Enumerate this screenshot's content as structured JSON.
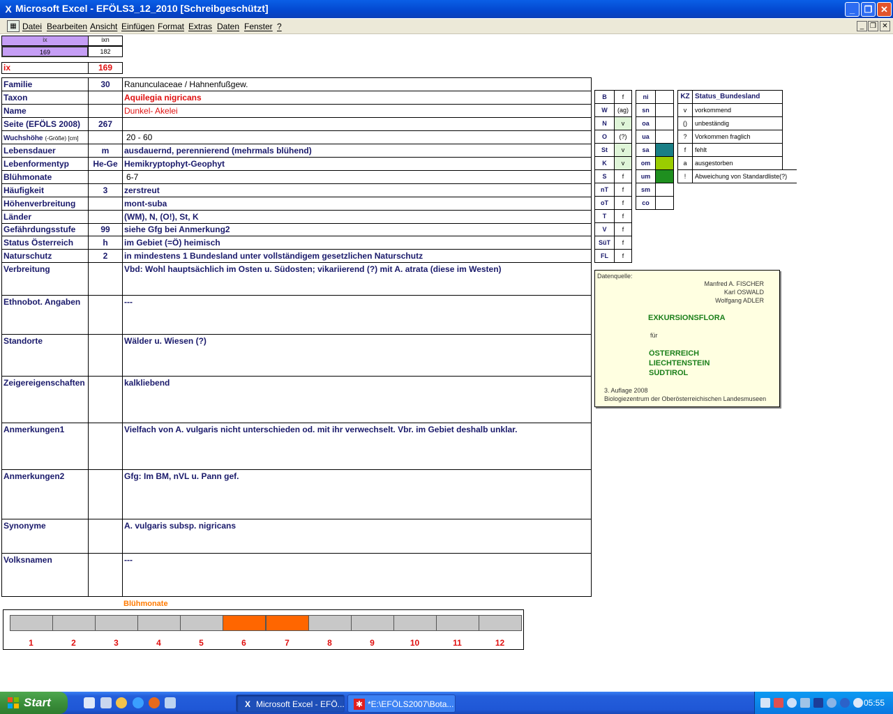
{
  "window": {
    "title": "Microsoft Excel - EFÖLS3_12_2010  [Schreibgeschützt]"
  },
  "menu": [
    "Datei",
    "Bearbeiten",
    "Ansicht",
    "Einfügen",
    "Format",
    "Extras",
    "Daten",
    "Fenster",
    "?"
  ],
  "top": {
    "ix_header": "ix",
    "ixn_header": "ixn",
    "ix_value": "169",
    "ixn_value": "182",
    "ix_label": "ix",
    "ix_big": "169"
  },
  "rows": [
    {
      "label": "Familie",
      "code": "30",
      "value": "Ranunculaceae  /  Hahnenfußgew."
    },
    {
      "label": "Taxon",
      "code": "",
      "value": "Aquilegia nigricans"
    },
    {
      "label": "Name",
      "code": "",
      "value": "Dunkel- Akelei"
    },
    {
      "label": "Seite (EFÖLS 2008)",
      "code": "267",
      "value": ""
    },
    {
      "label": "Wuchshöhe",
      "label_small": "(-Größe) [cm]",
      "code": "",
      "value": "20 - 60"
    },
    {
      "label": "Lebensdauer",
      "code": "m",
      "value": "ausdauernd, perennierend (mehrmals blühend)"
    },
    {
      "label": "Lebenformentyp",
      "code": "He-Ge",
      "value": "Hemikryptophyt-Geophyt"
    },
    {
      "label": "Blühmonate",
      "code": "",
      "value": "6-7"
    },
    {
      "label": "Häufigkeit",
      "code": "3",
      "value": "zerstreut"
    },
    {
      "label": "Höhenverbreitung",
      "code": "",
      "value": "mont-suba"
    },
    {
      "label": "Länder",
      "code": "",
      "value": "(WM), N, (O!), St, K"
    },
    {
      "label": "Gefährdungsstufe",
      "code": "99",
      "value": "siehe Gfg bei Anmerkung2"
    },
    {
      "label": "Status Österreich",
      "code": "h",
      "value": "im Gebiet (=Ö) heimisch"
    },
    {
      "label": "Naturschutz",
      "code": "2",
      "value": "in mindestens 1 Bundesland unter vollständigem gesetzlichen Naturschutz"
    }
  ],
  "big_rows": [
    {
      "label": "Verbreitung",
      "value": "Vbd: Wohl hauptsächlich im Osten u. Südosten; vikariierend (?) mit A. atrata (diese im Westen)"
    },
    {
      "label": "Ethnobot. Angaben",
      "value": "---"
    },
    {
      "label": "Standorte",
      "value": "Wälder u. Wiesen (?)"
    },
    {
      "label": "Zeigereigenschaften",
      "value": "kalkliebend"
    },
    {
      "label": "Anmerkungen1",
      "value": "Vielfach von A. vulgaris nicht unterschieden od. mit ihr verwechselt. Vbr. im Gebiet deshalb unklar."
    },
    {
      "label": "Anmerkungen2",
      "value": "Gfg: Im BM, nVL u. Pann gef."
    },
    {
      "label": "Synonyme",
      "value": "A. vulgaris subsp. nigricans"
    },
    {
      "label": "Volksnamen",
      "value": "---"
    }
  ],
  "states": [
    {
      "k": "B",
      "v": "f",
      "hl": false
    },
    {
      "k": "W",
      "v": "(ag)",
      "hl": false
    },
    {
      "k": "N",
      "v": "v",
      "hl": true
    },
    {
      "k": "O",
      "v": "(?)",
      "hl": false
    },
    {
      "k": "St",
      "v": "v",
      "hl": true
    },
    {
      "k": "K",
      "v": "v",
      "hl": true
    },
    {
      "k": "S",
      "v": "f",
      "hl": false
    },
    {
      "k": "nT",
      "v": "f",
      "hl": false
    },
    {
      "k": "oT",
      "v": "f",
      "hl": false
    },
    {
      "k": "T",
      "v": "f",
      "hl": false
    },
    {
      "k": "V",
      "v": "f",
      "hl": false
    },
    {
      "k": "SüT",
      "v": "f",
      "hl": false
    },
    {
      "k": "FL",
      "v": "f",
      "hl": false
    }
  ],
  "alt": [
    {
      "k": "ni",
      "c": "#ffffff"
    },
    {
      "k": "sn",
      "c": "#ffffff"
    },
    {
      "k": "oa",
      "c": "#ffffff"
    },
    {
      "k": "ua",
      "c": "#ffffff"
    },
    {
      "k": "sa",
      "c": "#1a7f86"
    },
    {
      "k": "om",
      "c": "#9acd00"
    },
    {
      "k": "um",
      "c": "#1f8f1f"
    },
    {
      "k": "sm",
      "c": "#ffffff"
    },
    {
      "k": "co",
      "c": "#ffffff"
    }
  ],
  "legend": {
    "kz": "KZ",
    "title": "Status_Bundesland",
    "items": [
      {
        "k": "v",
        "t": "vorkommend"
      },
      {
        "k": "()",
        "t": "unbeständig"
      },
      {
        "k": "?",
        "t": "Vorkommen fraglich"
      },
      {
        "k": "f",
        "t": "fehlt"
      },
      {
        "k": "a",
        "t": "ausgestorben"
      },
      {
        "k": "!",
        "t": "Abweichung von Standardliste(?)"
      }
    ]
  },
  "source": {
    "label": "Datenquelle:",
    "authors": [
      "Manfred A. FISCHER",
      "Karl OSWALD",
      "Wolfgang ADLER"
    ],
    "book": "EXKURSIONSFLORA",
    "fuer": "für",
    "countries": [
      "ÖSTERREICH",
      "LIECHTENSTEIN",
      "SÜDTIROL"
    ],
    "edition": "3. Auflage 2008",
    "publisher": "Biologiezentrum der Oberösterreichischen Landesmuseen"
  },
  "bloom": {
    "title": "Blühmonate",
    "months": [
      "1",
      "2",
      "3",
      "4",
      "5",
      "6",
      "7",
      "8",
      "9",
      "10",
      "11",
      "12"
    ],
    "active": [
      6,
      7
    ],
    "active_color": "#ff6600",
    "inactive_color": "#c8c8c8"
  },
  "taskbar": {
    "start": "Start",
    "tasks": [
      "Microsoft Excel - EFÖ...",
      "*E:\\EFÖLS2007\\Bota..."
    ],
    "clock": "05:55"
  }
}
